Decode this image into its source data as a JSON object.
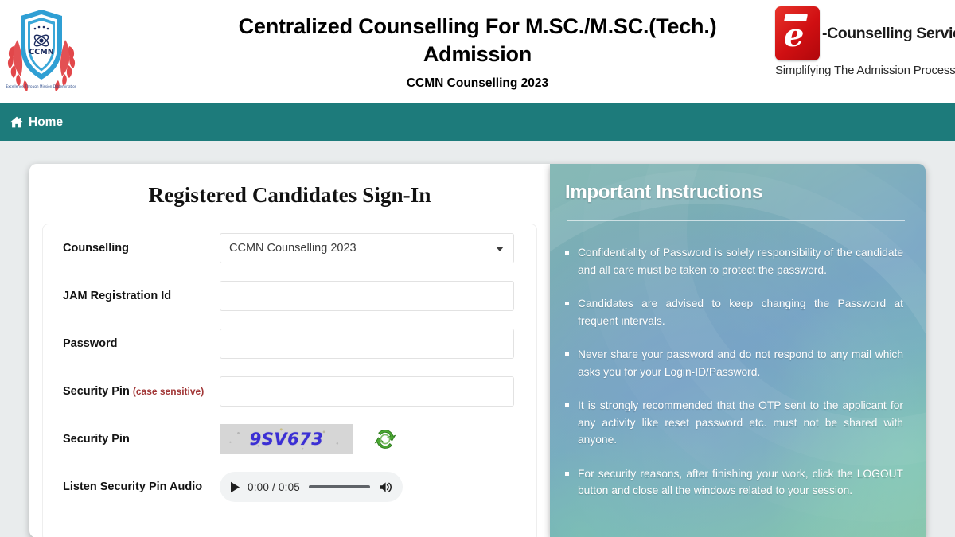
{
  "header": {
    "title": "Centralized Counselling For M.SC./M.SC.(Tech.) Admission",
    "subtitle": "CCMN Counselling 2023",
    "left_logo": {
      "name": "ccmn-logo",
      "text": "CCMN"
    },
    "right_logo": {
      "name": "e-counselling-services-logo",
      "mark_letter": "e",
      "name_text": "-Counselling Services",
      "tagline": "Simplifying The Admission Process"
    }
  },
  "navbar": {
    "background": "#1d7b7b",
    "items": [
      {
        "label": "Home",
        "icon": "home-icon"
      }
    ]
  },
  "login": {
    "heading": "Registered Candidates Sign-In",
    "fields": {
      "counselling": {
        "label": "Counselling",
        "value": "CCMN Counselling 2023",
        "options": [
          "CCMN Counselling 2023"
        ]
      },
      "jam_registration_id": {
        "label": "JAM Registration Id",
        "value": "",
        "placeholder": ""
      },
      "password": {
        "label": "Password",
        "value": "",
        "placeholder": ""
      },
      "security_pin_input": {
        "label": "Security Pin",
        "label_note": "(case sensitive)",
        "value": "",
        "placeholder": ""
      },
      "security_pin_image": {
        "label": "Security Pin",
        "captcha_text": "9SV673",
        "refresh_icon": "refresh-icon"
      },
      "security_pin_audio": {
        "label": "Listen Security Pin Audio",
        "current_time": "0:00",
        "duration": "0:05",
        "time_display": "0:00 / 0:05",
        "play_icon": "play-icon",
        "volume_icon": "volume-icon"
      }
    }
  },
  "instructions": {
    "title": "Important Instructions",
    "items": [
      "Confidentiality of Password is solely responsibility of the candidate and all care must be taken to protect the password.",
      "Candidates are advised to keep changing the Password at frequent intervals.",
      "Never share your password and do not respond to any mail which asks you for your Login-ID/Password.",
      "It is strongly recommended that the OTP sent to the applicant for any activity like reset password etc. must not be shared with anyone.",
      "For security reasons, after finishing your work, click the LOGOUT button and close all the windows related to your session."
    ]
  },
  "colors": {
    "nav_teal": "#1d7b7b",
    "page_background": "#e9eced",
    "note_red": "#a13636",
    "captcha_blue": "#3b2fd4",
    "refresh_green": "#3d9b2f",
    "logo_red": "#d00f12"
  }
}
